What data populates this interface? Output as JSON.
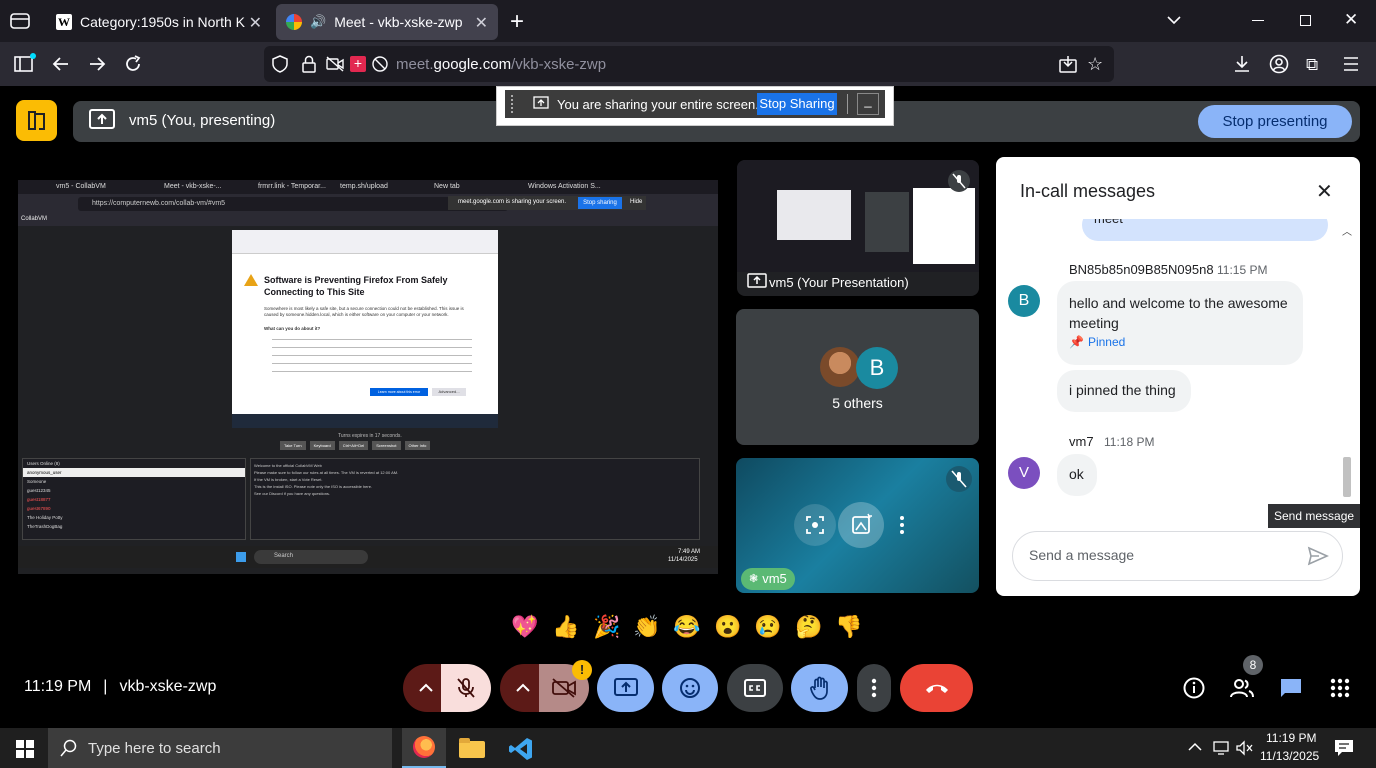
{
  "browser": {
    "tabs": [
      {
        "label": "Category:1950s in North Korea",
        "icon": "wikipedia-icon"
      },
      {
        "label": "Meet - vkb-xske-zwp",
        "icon": "meet-icon"
      }
    ],
    "new_tab": "+",
    "url_prefix": "meet.",
    "url_domain": "google.com",
    "url_path": "/vkb-xske-zwp"
  },
  "sharing_bar": {
    "message": "You are sharing your entire screen.",
    "stop_label": "Stop Sharing",
    "hide_label": "_"
  },
  "presenting_banner": {
    "label": "vm5 (You, presenting)",
    "stop_button": "Stop presenting"
  },
  "shared_screen": {
    "tabs": [
      "vm5 - CollabVM",
      "Meet - vkb-xske-...",
      "frmrr.link - Temporar...",
      "temp.sh/upload",
      "New tab",
      "Windows Activation S..."
    ],
    "url": "https://computernewb.com/collab-vm/#vm5",
    "sharing_text": "meet.google.com is sharing your screen.",
    "sharing_stop": "Stop sharing",
    "sharing_hide": "Hide",
    "error_title": "Software is Preventing Firefox From Safely Connecting to This Site",
    "error_body": "Somewhere is most likely a safe site, but a secure connection could not be established. This issue is caused by someone.hidden.local, which is either software on your computer or your network.",
    "error_sub": "What can you do about it?",
    "error_btn_primary": "Learn more about this error",
    "error_btn_secondary": "Advanced...",
    "collab_header": "CollabVM",
    "turn_text": "Turns expires in 17 seconds.",
    "buttons": [
      "Take Turn",
      "Keyboard",
      "Ctrl+Alt+Del",
      "Screenshot",
      "Other Info"
    ],
    "users_title": "Users Online (8)",
    "users": [
      "anonymous_user",
      "Someone",
      "guest12345",
      "guest18877",
      "guest67890",
      "The Holiday Potty",
      "TheTrashDogBag"
    ],
    "chat_lines": [
      "Welcome to the official CollabVM Web",
      "Please make sure to follow our rules at all times. The VM is reverted at 12:00 AM.",
      "If the VM is broken, start a Vote Reset.",
      "This is the install ISO. Please note only the ISO is accessible here.",
      "See our Discord if you have any questions."
    ],
    "taskbar_search": "Search",
    "time": "7:49 AM",
    "date": "11/14/2025"
  },
  "tiles": {
    "presentation_label": "vm5 (Your Presentation)",
    "others_initial": "B",
    "others_label": "5 others",
    "self_label": "vm5"
  },
  "chat": {
    "title": "In-call messages",
    "close": "✕",
    "messages": [
      {
        "sender": "BN85b85n09B85N095n8",
        "time": "11:15 PM",
        "initial": "B",
        "texts": [
          "hello and welcome to the awesome meeting",
          "i pinned the thing"
        ],
        "pinned": "Pinned"
      },
      {
        "sender": "vm7",
        "time": "11:18 PM",
        "initial": "V",
        "texts": [
          "ok"
        ]
      }
    ],
    "partial_text": "meet",
    "input_placeholder": "Send a message",
    "tooltip": "Send message"
  },
  "reactions": [
    "💖",
    "👍",
    "🎉",
    "👏",
    "😂",
    "😮",
    "😢",
    "🤔",
    "👎"
  ],
  "bottom": {
    "time": "11:19 PM",
    "separator": "|",
    "meeting_code": "vkb-xske-zwp",
    "people_count": "8",
    "warning": "!"
  },
  "taskbar": {
    "search_placeholder": "Type here to search",
    "time": "11:19 PM",
    "date": "11/13/2025"
  },
  "colors": {
    "meet_accent": "#8ab4f8",
    "end_call": "#ea4335",
    "mic_off_bg": "#f9dedc",
    "avatar_b": "#1a8aa0",
    "avatar_v": "#7b4fbf",
    "self_label_bg": "#5bb974"
  }
}
